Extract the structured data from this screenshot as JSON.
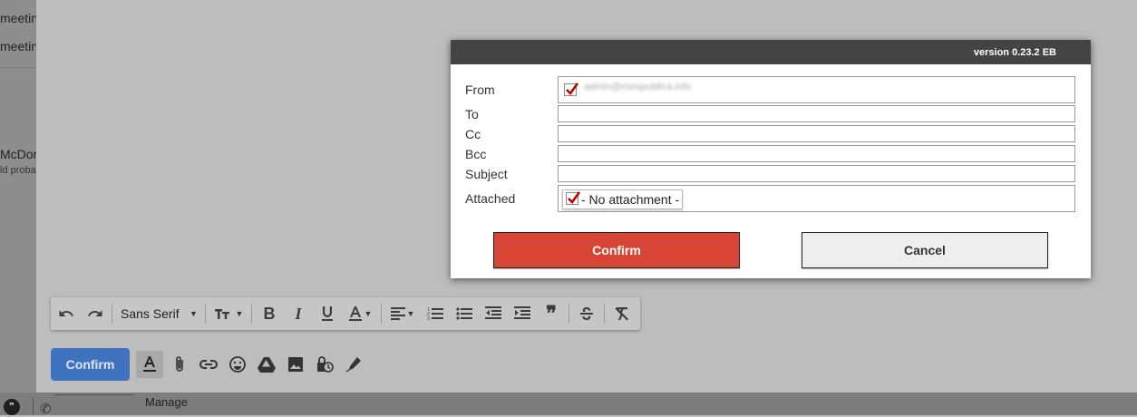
{
  "background": {
    "list_rows": [
      "meetin",
      "meetin",
      "McDon",
      "ld proba"
    ],
    "manage_label": "Manage"
  },
  "toolbar": {
    "font_name": "Sans Serif",
    "icons": [
      "undo-icon",
      "redo-icon",
      "font-size-icon",
      "bold-icon",
      "italic-icon",
      "underline-icon",
      "text-color-icon",
      "align-icon",
      "numbered-list-icon",
      "bulleted-list-icon",
      "indent-less-icon",
      "indent-more-icon",
      "quote-icon",
      "strikethrough-icon",
      "remove-formatting-icon"
    ]
  },
  "compose": {
    "send_label": "Confirm"
  },
  "dialog": {
    "version": "version 0.23.2 EB",
    "labels": {
      "from": "From",
      "to": "To",
      "cc": "Cc",
      "bcc": "Bcc",
      "subject": "Subject",
      "attached": "Attached"
    },
    "from_value": "admin@mirepublica.info",
    "to_value": "",
    "cc_value": "",
    "bcc_value": "",
    "subject_value": "",
    "attachment_label": "- No attachment -",
    "confirm_label": "Confirm",
    "cancel_label": "Cancel"
  },
  "colors": {
    "confirm_red": "#d94535",
    "send_blue": "#3f73c0",
    "check_red": "#c00000"
  }
}
